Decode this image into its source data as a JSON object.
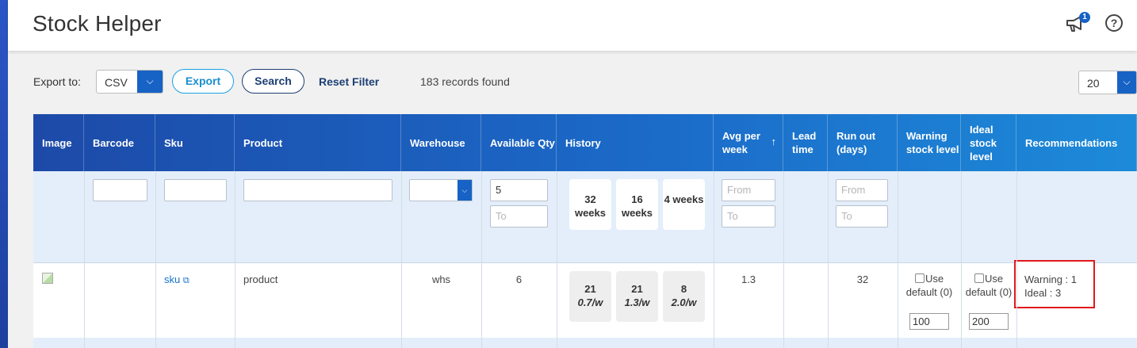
{
  "header": {
    "title": "Stock Helper",
    "notifications_count": "1",
    "help_symbol": "?"
  },
  "toolbar": {
    "export_label": "Export to:",
    "export_format": "CSV",
    "export_button": "Export",
    "search_button": "Search",
    "reset_filter": "Reset Filter",
    "records_found": "183 records found",
    "page_size": "20"
  },
  "columns": {
    "image": "Image",
    "barcode": "Barcode",
    "sku": "Sku",
    "product": "Product",
    "warehouse": "Warehouse",
    "available_qty": "Available Qty",
    "history": "History",
    "avg_per_week": "Avg per week",
    "lead_time": "Lead time",
    "run_out": "Run out (days)",
    "warning_level": "Warning stock level",
    "ideal_level": "Ideal stock level",
    "recommendations": "Recommendations"
  },
  "filters": {
    "available_qty_from": "5",
    "available_qty_to_placeholder": "To",
    "history_cards": [
      "32 weeks",
      "16 weeks",
      "4 weeks"
    ],
    "avg_from_placeholder": "From",
    "avg_to_placeholder": "To",
    "runout_from_placeholder": "From",
    "runout_to_placeholder": "To"
  },
  "rows": [
    {
      "sku": "sku",
      "product": "product",
      "warehouse": "whs",
      "available_qty": "6",
      "history": [
        {
          "count": "21",
          "rate": "0.7/w"
        },
        {
          "count": "21",
          "rate": "1.3/w"
        },
        {
          "count": "8",
          "rate": "2.0/w"
        }
      ],
      "avg_per_week": "1.3",
      "run_out": "32",
      "warning_use_default": "Use default (0)",
      "warning_value": "100",
      "ideal_use_default": "Use default (0)",
      "ideal_value": "200",
      "rec_warning": "Warning : 1",
      "rec_ideal": "Ideal : 3"
    }
  ],
  "colors": {
    "accent": "#1762c5",
    "header_start": "#1d4aa8",
    "header_end": "#1d8ad8",
    "highlight_border": "#e0191d"
  }
}
